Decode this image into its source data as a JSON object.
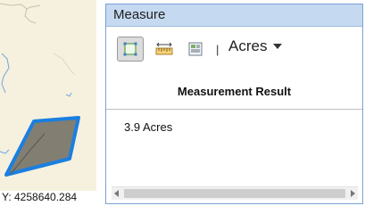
{
  "map": {
    "coordinate_text": "Y: 4258640.284"
  },
  "widget": {
    "title": "Measure",
    "tools": [
      {
        "name": "area-tool",
        "icon": "area-measure-icon",
        "active": true
      },
      {
        "name": "distance-tool",
        "icon": "ruler-icon",
        "active": false
      },
      {
        "name": "location-tool",
        "icon": "location-icon",
        "active": false
      }
    ],
    "separator": "|",
    "unit_selected": "Acres",
    "result_header": "Measurement Result",
    "result_value": "3.9 Acres"
  },
  "colors": {
    "titlebar": "#c5d9f1",
    "polygon_stroke": "#1a7fe0",
    "polygon_fill": "#6d6a5f",
    "map_bg": "#f6f1de"
  }
}
